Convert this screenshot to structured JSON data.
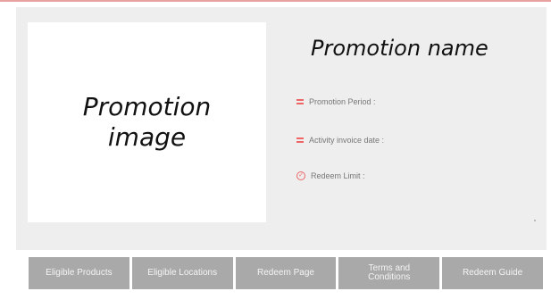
{
  "promotion": {
    "image_placeholder": "Promotion image",
    "name_placeholder": "Promotion name",
    "details": [
      {
        "icon": "list-icon",
        "label": "Promotion Period :"
      },
      {
        "icon": "list-icon",
        "label": "Activity invoice date :"
      },
      {
        "icon": "check-circle-icon",
        "label": "Redeem Limit :"
      }
    ]
  },
  "nav_buttons": [
    {
      "label": "Eligible Products"
    },
    {
      "label": "Eligible Locations"
    },
    {
      "label": "Redeem Page"
    },
    {
      "label": "Terms and Conditions"
    },
    {
      "label": "Redeem Guide"
    }
  ],
  "colors": {
    "accent": "#e66666",
    "panel_bg": "#eeeeee",
    "button_bg": "#a9a9a9",
    "button_text": "#f4f4f4"
  }
}
